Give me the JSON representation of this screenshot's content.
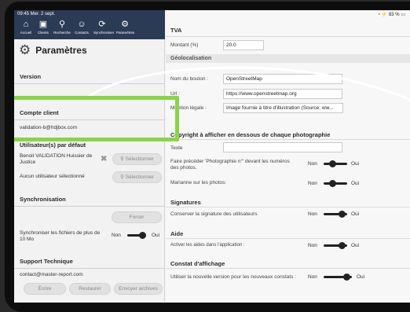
{
  "status": {
    "time": "09:45  Mer. 2 sept.",
    "battery": "83 %"
  },
  "toolbar": {
    "items": [
      {
        "icon": "home-icon",
        "label": "Accueil"
      },
      {
        "icon": "clients-icon",
        "label": "Clients"
      },
      {
        "icon": "search-icon",
        "label": "Recherche"
      },
      {
        "icon": "contacts-icon",
        "label": "Contacts"
      },
      {
        "icon": "sync-icon",
        "label": "Synchroniser"
      },
      {
        "icon": "settings-icon",
        "label": "Paramètres"
      }
    ]
  },
  "left": {
    "title": "Paramètres",
    "version_header": "Version",
    "account_header": "Compte client",
    "account_email": "validation-b@hdjbox.com",
    "users_header": "Utilisateur(s) par défaut",
    "user1_name": "Benoit VALIDATION Huissier de Justice",
    "user2_name": "Aucun utilisateur sélectionné",
    "select_label": "Sélectionner",
    "sync_header": "Synchronisation",
    "force_label": "Forcer",
    "sync_files_label": "Synchroniser les fichiers de plus de 10 Mo",
    "non": "Non",
    "oui": "Oui",
    "support_header": "Support Technique",
    "support_email": "contact@master-report.com",
    "write_label": "Écrire",
    "restore_label": "Restaurer",
    "send_archives_label": "Envoyer archives"
  },
  "right": {
    "tva_header": "TVA",
    "amount_label": "Montant (%)",
    "amount_value": "20.0",
    "geo_header": "Géolocalisation",
    "button_name_label": "Nom du bouton :",
    "button_name_value": "OpenStreetMap",
    "url_label": "Url :",
    "url_value": "https://www.openstreetmap.org",
    "legal_label": "Mention légale :",
    "legal_value": "Image fournie à titre d'illustration (Source: ww...",
    "copyright_header": "Copyright à afficher en dessous de chaque photographie",
    "text_label": "Texte",
    "text_value": "",
    "prefix_label": "Faire précéder 'Photographie n°' devant les numéros des photos.",
    "marianne_label": "Marianne sur les photos:",
    "signatures_header": "Signatures",
    "keep_signature_label": "Conserver la signature des utilisateurs",
    "aide_header": "Aide",
    "aide_label": "Activer les aides dans l'application :",
    "constat_header": "Constat d'affichage",
    "constat_label": "Utiliser la nouvelle version pour les nouveaux constats :",
    "non": "Non",
    "oui": "Oui"
  },
  "colors": {
    "toolbar": "#2b3a55",
    "highlight": "#8cd24d",
    "toggle": "#222222"
  }
}
